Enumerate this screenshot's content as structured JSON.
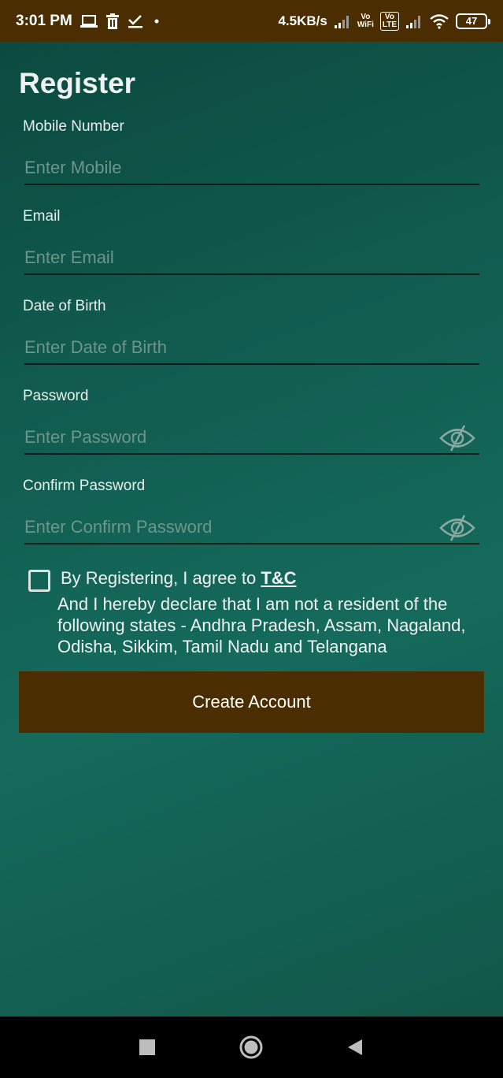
{
  "status_bar": {
    "time": "3:01 PM",
    "speed": "4.5KB/s",
    "vowifi_top": "Vo",
    "vowifi_bottom": "WiFi",
    "volte_top": "Vo",
    "volte_bottom": "LTE",
    "battery": "47",
    "icons": [
      "laptop-icon",
      "trash-icon",
      "check-icon",
      "dot-icon",
      "signal-icon",
      "wifi-icon",
      "battery-icon"
    ]
  },
  "page": {
    "title": "Register"
  },
  "form": {
    "fields": [
      {
        "label": "Mobile Number",
        "placeholder": "Enter Mobile",
        "value": ""
      },
      {
        "label": "Email",
        "placeholder": "Enter Email",
        "value": ""
      },
      {
        "label": "Date of Birth",
        "placeholder": "Enter Date of Birth",
        "value": ""
      },
      {
        "label": "Password",
        "placeholder": "Enter Password",
        "value": "",
        "icon": "eye-slash-icon"
      },
      {
        "label": "Confirm Password",
        "placeholder": "Enter Confirm Password",
        "value": "",
        "icon": "eye-slash-icon"
      }
    ],
    "agree_text": "By Registering, I agree to ",
    "tc_link": "T&C",
    "declaration": "And I hereby declare that I am not a resident of the following states - Andhra Pradesh, Assam, Nagaland, Odisha, Sikkim, Tamil Nadu and Telangana",
    "checked": false,
    "submit_label": "Create Account"
  },
  "nav_bar": {
    "buttons": [
      "recents-square-icon",
      "home-circle-icon",
      "back-triangle-icon"
    ]
  },
  "colors": {
    "accent_brown": "#4a2d00",
    "background_teal": "#136456"
  }
}
